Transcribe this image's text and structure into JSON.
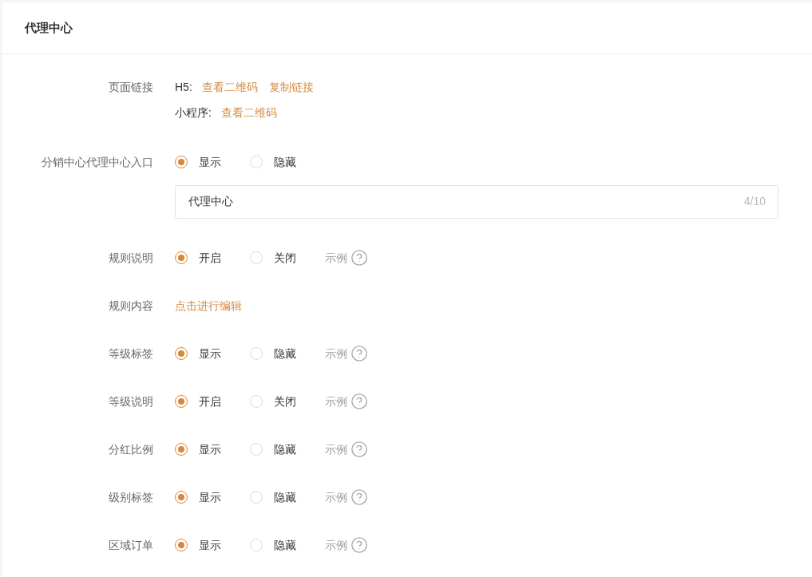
{
  "title": "代理中心",
  "rows": [
    {
      "kind": "links",
      "label": "页面链接",
      "lines": [
        {
          "prefix": "H5:",
          "links": [
            "查看二维码",
            "复制链接"
          ]
        },
        {
          "prefix": "小程序:",
          "links": [
            "查看二维码"
          ]
        }
      ]
    },
    {
      "kind": "radio",
      "label": "分销中心代理中心入口",
      "options": [
        {
          "label": "显示",
          "selected": true
        },
        {
          "label": "隐藏",
          "selected": false
        }
      ],
      "input": {
        "value": "代理中心",
        "counter": "4/10"
      }
    },
    {
      "kind": "radio",
      "label": "规则说明",
      "options": [
        {
          "label": "开启",
          "selected": true
        },
        {
          "label": "关闭",
          "selected": false
        }
      ],
      "example": "示例"
    },
    {
      "kind": "link",
      "label": "规则内容",
      "link": "点击进行编辑"
    },
    {
      "kind": "radio",
      "label": "等级标签",
      "options": [
        {
          "label": "显示",
          "selected": true
        },
        {
          "label": "隐藏",
          "selected": false
        }
      ],
      "example": "示例"
    },
    {
      "kind": "radio",
      "label": "等级说明",
      "options": [
        {
          "label": "开启",
          "selected": true
        },
        {
          "label": "关闭",
          "selected": false
        }
      ],
      "example": "示例"
    },
    {
      "kind": "radio",
      "label": "分红比例",
      "options": [
        {
          "label": "显示",
          "selected": true
        },
        {
          "label": "隐藏",
          "selected": false
        }
      ],
      "example": "示例"
    },
    {
      "kind": "radio",
      "label": "级别标签",
      "options": [
        {
          "label": "显示",
          "selected": true
        },
        {
          "label": "隐藏",
          "selected": false
        }
      ],
      "example": "示例"
    },
    {
      "kind": "radio",
      "label": "区域订单",
      "options": [
        {
          "label": "显示",
          "selected": true
        },
        {
          "label": "隐藏",
          "selected": false
        }
      ],
      "example": "示例"
    }
  ]
}
